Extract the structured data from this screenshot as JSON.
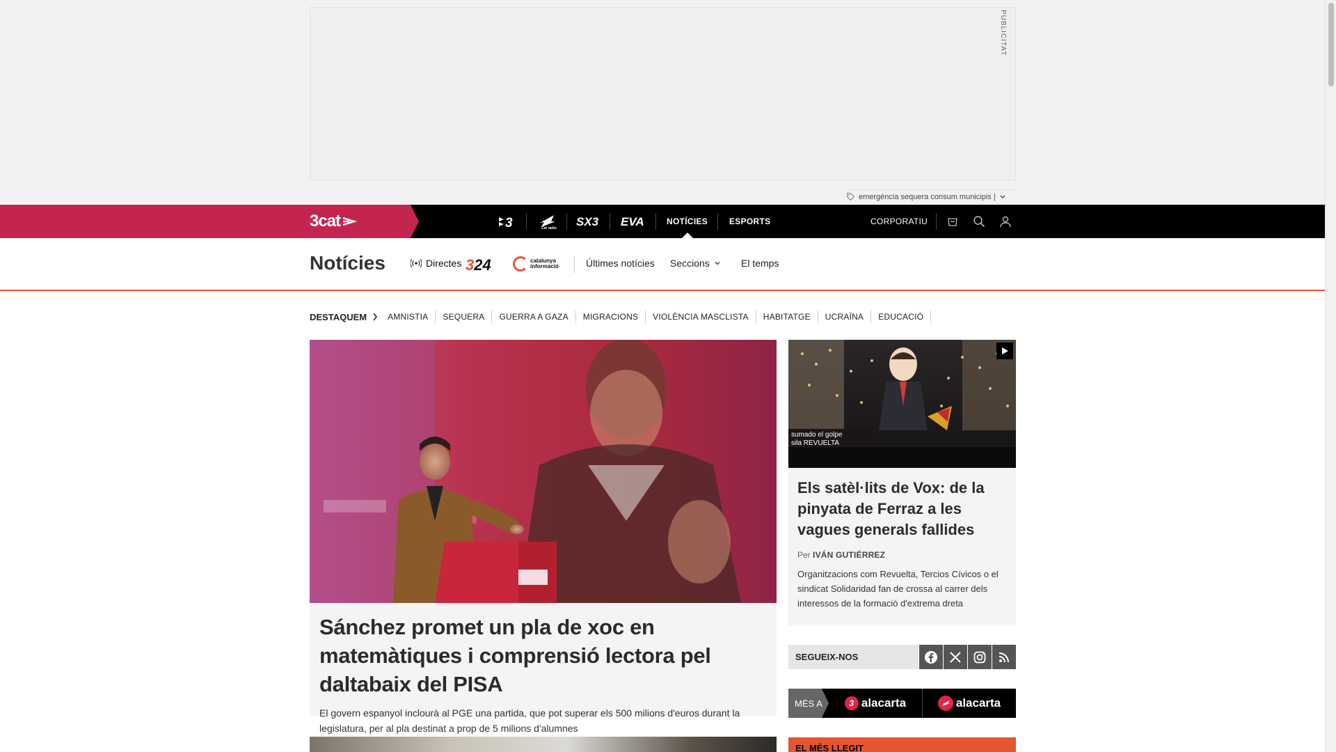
{
  "ad": {
    "label": "PUBLICITAT",
    "tags_text": "emergència sequera consum municipis |"
  },
  "topbar": {
    "brand": "3cat",
    "channels": [
      "3",
      "Cat ràdio",
      "SX3",
      "EVA"
    ],
    "nav": {
      "noticies": "NOTÍCIES",
      "esports": "ESPORTS",
      "corporatiu": "CORPORATIU"
    },
    "icons": [
      "shop-icon",
      "search-icon",
      "user-icon"
    ]
  },
  "section": {
    "title": "Notícies",
    "directes": "Directes",
    "logo_324_a": "3",
    "logo_324_b": "24",
    "catinfo": "catalunya informació",
    "links": {
      "ultimes": "Últimes notícies",
      "seccions": "Seccions",
      "temps": "El temps"
    }
  },
  "tags": {
    "head": "DESTAQUEM",
    "items": [
      "AMNISTIA",
      "SEQUERA",
      "GUERRA A GAZA",
      "MIGRACIONS",
      "VIOLÈNCIA MASCLISTA",
      "HABITATGE",
      "UCRAÏNA",
      "EDUCACIÓ"
    ]
  },
  "main_article": {
    "headline": "Sánchez promet un pla de xoc en matemàtiques i comprensió lectora pel daltabaix del PISA",
    "summary": "El govern espanyol inclourà al PGE una partida, que pot superar els 500 milions d'euros durant la legislatura, per al pla destinat a prop de 5 milions d'alumnes"
  },
  "side_article": {
    "headline": "Els satèl·lits de Vox: de la pinyata de Ferraz a les vagues generals fallides",
    "author_prefix": "Per",
    "author": "IVÁN GUTIÉRREZ",
    "summary": "Organitzacions com Revuelta, Tercios Cívicos o el sindicat Solidaridad fan de crossa al carrer dels interessos de la formació d'extrema dreta"
  },
  "follow": {
    "label": "SEGUEIX-NOS",
    "networks": [
      "facebook-icon",
      "x-icon",
      "instagram-icon",
      "rss-icon"
    ]
  },
  "mesa": {
    "label": "MÉS A",
    "items": [
      {
        "badge": "3",
        "text": "alacarta"
      },
      {
        "badge": "",
        "text": "alacarta"
      }
    ]
  },
  "most_read": {
    "label": "EL MÉS LLEGIT"
  },
  "colors": {
    "brand_pink": "#c4254f",
    "accent_orange": "#e4572e",
    "black": "#000000"
  }
}
